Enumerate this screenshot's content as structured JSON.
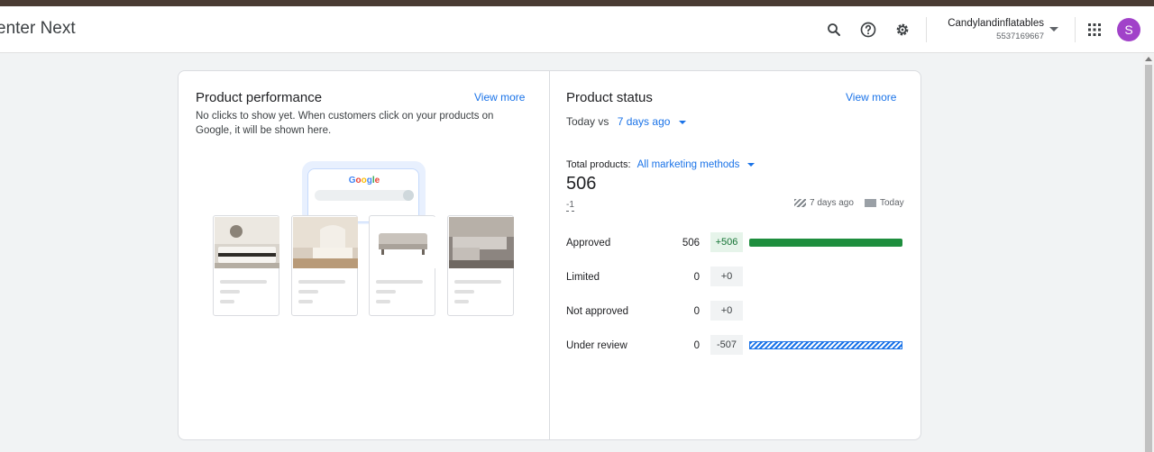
{
  "header": {
    "app_title": "enter Next",
    "account_name": "Candylandinflatables",
    "account_id": "5537169667",
    "avatar_letter": "S",
    "icons": [
      "search-icon",
      "help-icon",
      "settings-icon",
      "apps-grid-icon"
    ]
  },
  "performance": {
    "title": "Product performance",
    "view_more": "View more",
    "description": "No clicks to show yet. When customers click on your products on Google, it will be shown here.",
    "google_logo": "Google"
  },
  "status": {
    "title": "Product status",
    "view_more": "View more",
    "today_vs": "Today vs",
    "compare_period": "7 days ago",
    "total_products_label": "Total products:",
    "marketing_methods": "All marketing methods",
    "total": "506",
    "total_delta": "-1",
    "legend_prev": "7 days ago",
    "legend_today": "Today",
    "rows": [
      {
        "label": "Approved",
        "count": "506",
        "delta": "+506",
        "bar_fraction": 1.0,
        "bar_style": "today"
      },
      {
        "label": "Limited",
        "count": "0",
        "delta": "+0",
        "bar_fraction": 0,
        "bar_style": "none"
      },
      {
        "label": "Not approved",
        "count": "0",
        "delta": "+0",
        "bar_fraction": 0,
        "bar_style": "none"
      },
      {
        "label": "Under review",
        "count": "0",
        "delta": "-507",
        "bar_fraction": 1.0,
        "bar_style": "7-days-ago"
      }
    ]
  },
  "colors": {
    "accent": "#1a73e8",
    "approved_bar": "#1e8e3e",
    "positive_delta_bg": "#e6f4ea",
    "avatar": "#a142c9"
  }
}
